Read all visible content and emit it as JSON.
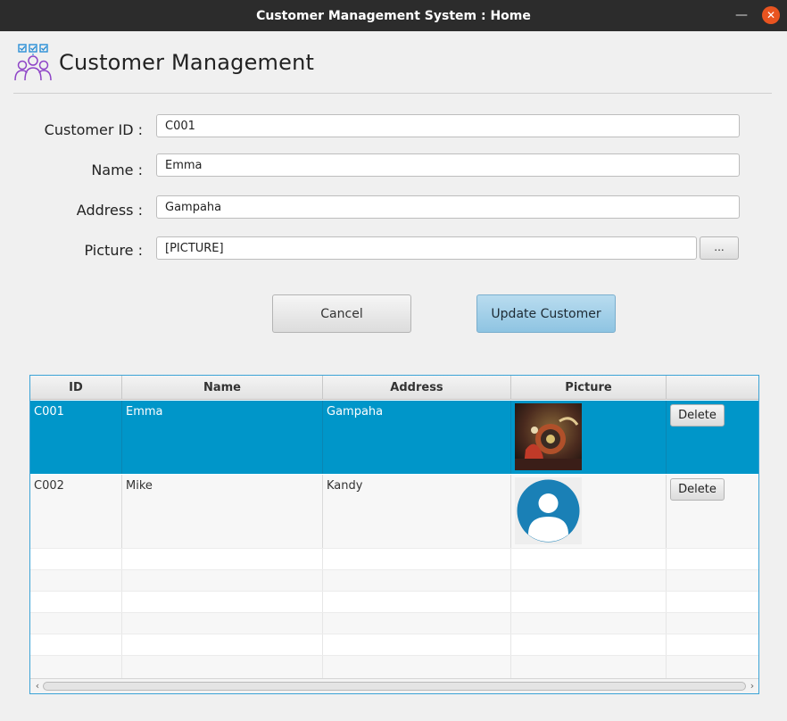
{
  "window": {
    "title": "Customer Management System : Home"
  },
  "header": {
    "title": "Customer Management",
    "icon": "customers-icon"
  },
  "form": {
    "customer_id": {
      "label": "Customer ID :",
      "value": "C001"
    },
    "name": {
      "label": "Name :",
      "value": "Emma"
    },
    "address": {
      "label": "Address :",
      "value": "Gampaha"
    },
    "picture": {
      "label": "Picture :",
      "value": "[PICTURE]",
      "browse_label": "..."
    }
  },
  "buttons": {
    "cancel": "Cancel",
    "update": "Update Customer"
  },
  "table": {
    "columns": [
      "ID",
      "Name",
      "Address",
      "Picture",
      ""
    ],
    "rows": [
      {
        "id": "C001",
        "name": "Emma",
        "address": "Gampaha",
        "picture": "photo-thumbnail",
        "action": "Delete",
        "selected": true
      },
      {
        "id": "C002",
        "name": "Mike",
        "address": "Kandy",
        "picture": "default-avatar-icon",
        "action": "Delete",
        "selected": false
      }
    ]
  },
  "colors": {
    "accent": "#0096c9",
    "update_button": "#9fcde6",
    "close_button": "#e95420",
    "titlebar": "#2c2c2c"
  }
}
